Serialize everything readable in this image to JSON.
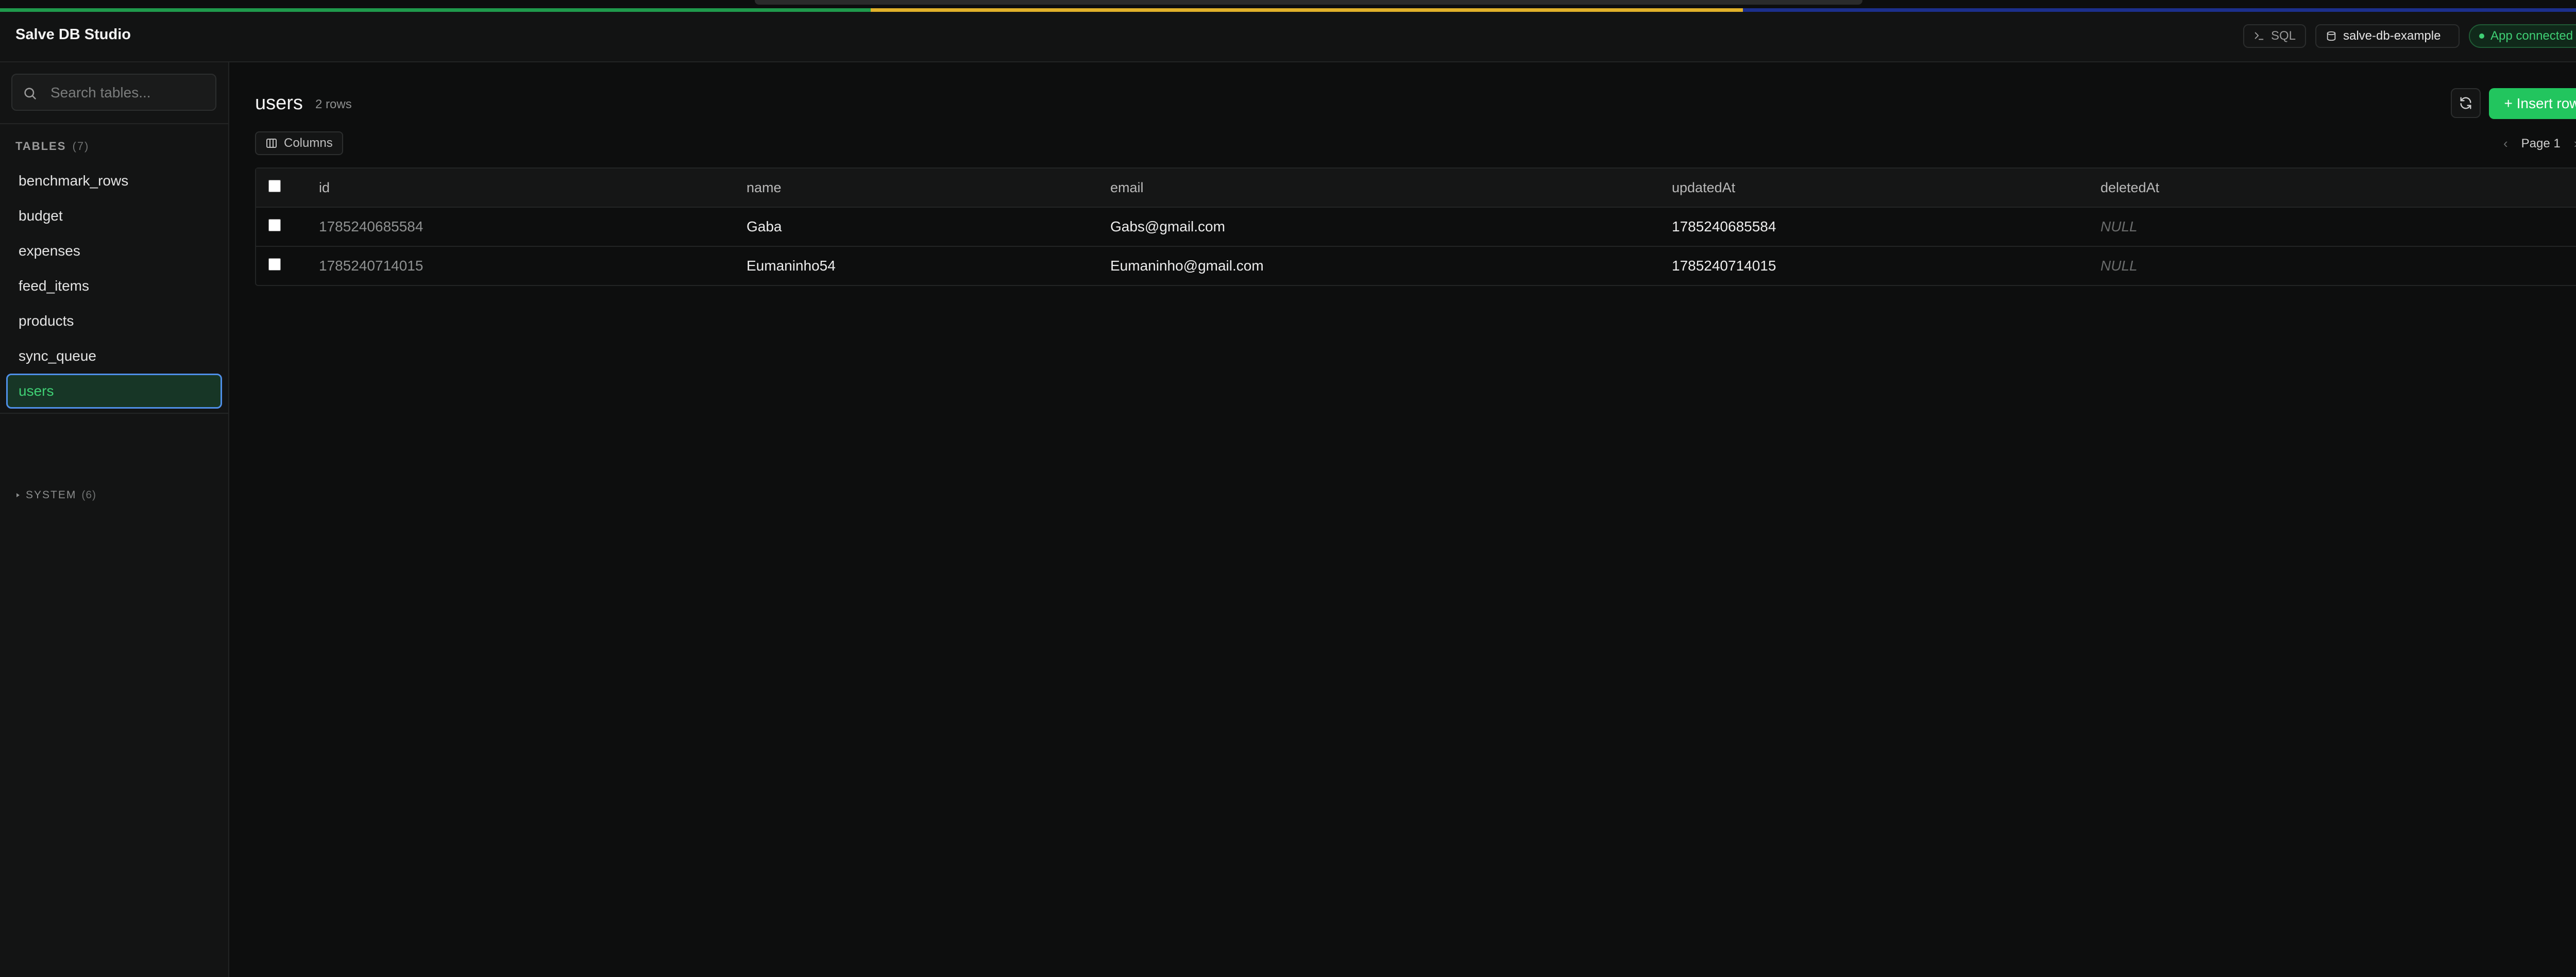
{
  "app": {
    "title": "Salve DB Studio"
  },
  "header": {
    "sql_label": "SQL",
    "project_label": "salve-db-example",
    "connection_label": "App connected",
    "colors": {
      "accent_green": "#22c55e",
      "connected_text": "#3fcf74"
    }
  },
  "sidebar": {
    "search_placeholder": "Search tables...",
    "tables_label": "TABLES",
    "tables_count": "(7)",
    "tables": [
      {
        "label": "benchmark_rows"
      },
      {
        "label": "budget"
      },
      {
        "label": "expenses"
      },
      {
        "label": "feed_items"
      },
      {
        "label": "products"
      },
      {
        "label": "sync_queue"
      },
      {
        "label": "users",
        "active": true
      }
    ],
    "system_label": "SYSTEM",
    "system_count": "(6)"
  },
  "main": {
    "title": "users",
    "row_count": "2 rows",
    "insert_label": "+ Insert row",
    "columns_label": "Columns",
    "page_label": "Page 1",
    "table": {
      "headers": [
        "id",
        "name",
        "email",
        "updatedAt",
        "deletedAt"
      ],
      "rows": [
        [
          "1785240685584",
          "Gaba",
          "Gabs@gmail.com",
          "1785240685584",
          "NULL"
        ],
        [
          "1785240714015",
          "Eumaninho54",
          "Eumaninho@gmail.com",
          "1785240714015",
          "NULL"
        ]
      ]
    }
  }
}
